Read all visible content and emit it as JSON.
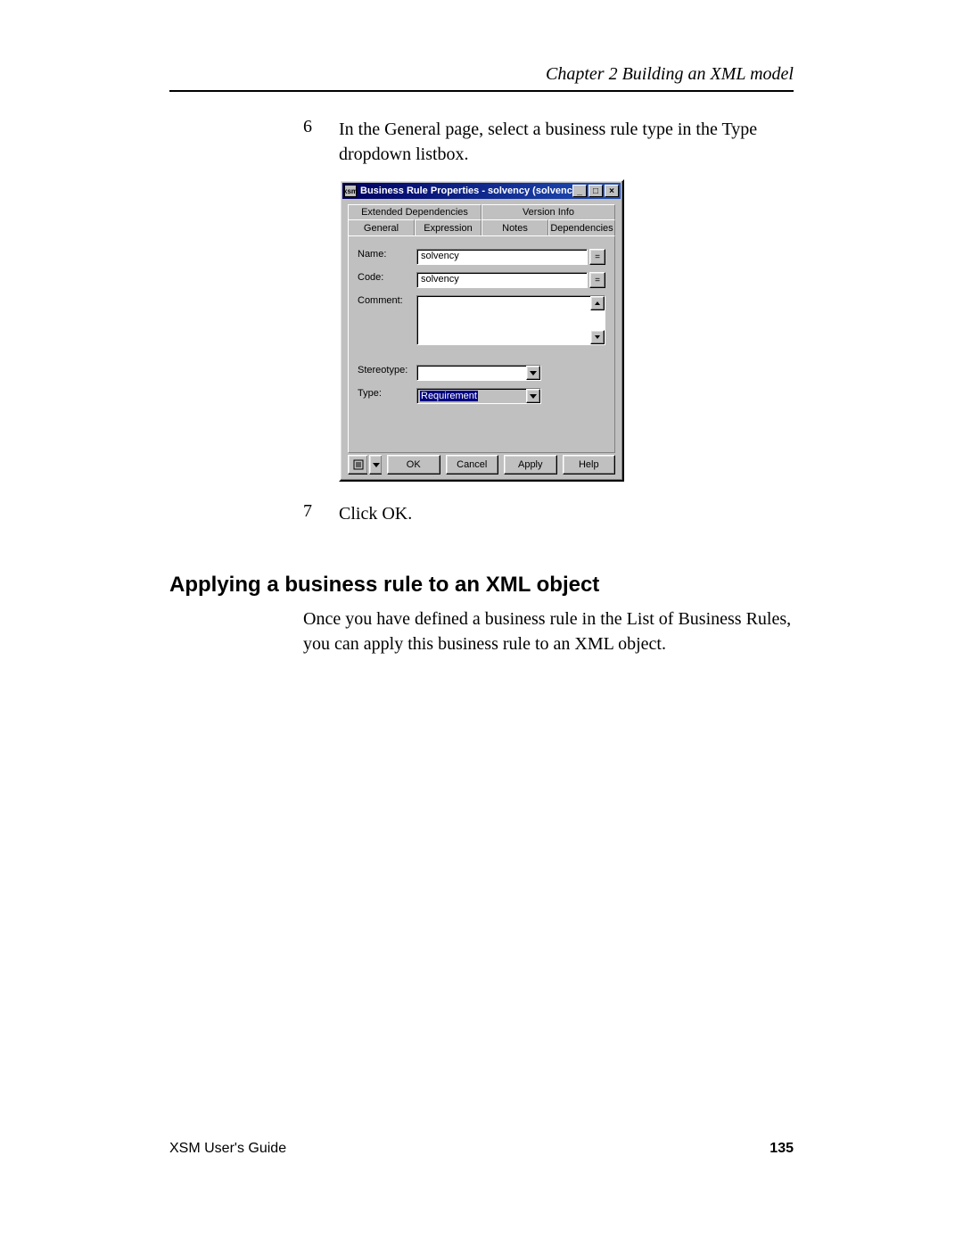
{
  "header": {
    "chapter": "Chapter 2  Building an XML model"
  },
  "steps": {
    "s6_num": "6",
    "s6_text": "In the General page, select a business rule type in the Type dropdown listbox.",
    "s7_num": "7",
    "s7_text": "Click OK."
  },
  "dialog": {
    "title": "Business Rule Properties - solvency (solvency)",
    "sys_icon_glyph": "xsm",
    "win_min": "_",
    "win_max": "□",
    "win_close": "×",
    "tabs_back": [
      "Extended Dependencies",
      "Version Info"
    ],
    "tabs_front": [
      "General",
      "Expression",
      "Notes",
      "Dependencies"
    ],
    "active_tab": "General",
    "fields": {
      "name_label": "Name:",
      "name_value": "solvency",
      "name_btn": "=",
      "code_label": "Code:",
      "code_value": "solvency",
      "code_btn": "=",
      "comment_label": "Comment:",
      "stereotype_label": "Stereotype:",
      "stereotype_value": "",
      "type_label": "Type:",
      "type_value": "Requirement"
    },
    "buttons": {
      "ok": "OK",
      "cancel": "Cancel",
      "apply": "Apply",
      "help": "Help"
    }
  },
  "section": {
    "heading": "Applying a business rule to an XML object",
    "para": "Once you have defined a business rule in the List of Business Rules, you can apply this business rule to an XML object."
  },
  "footer": {
    "guide": "XSM User's Guide",
    "page": "135"
  }
}
